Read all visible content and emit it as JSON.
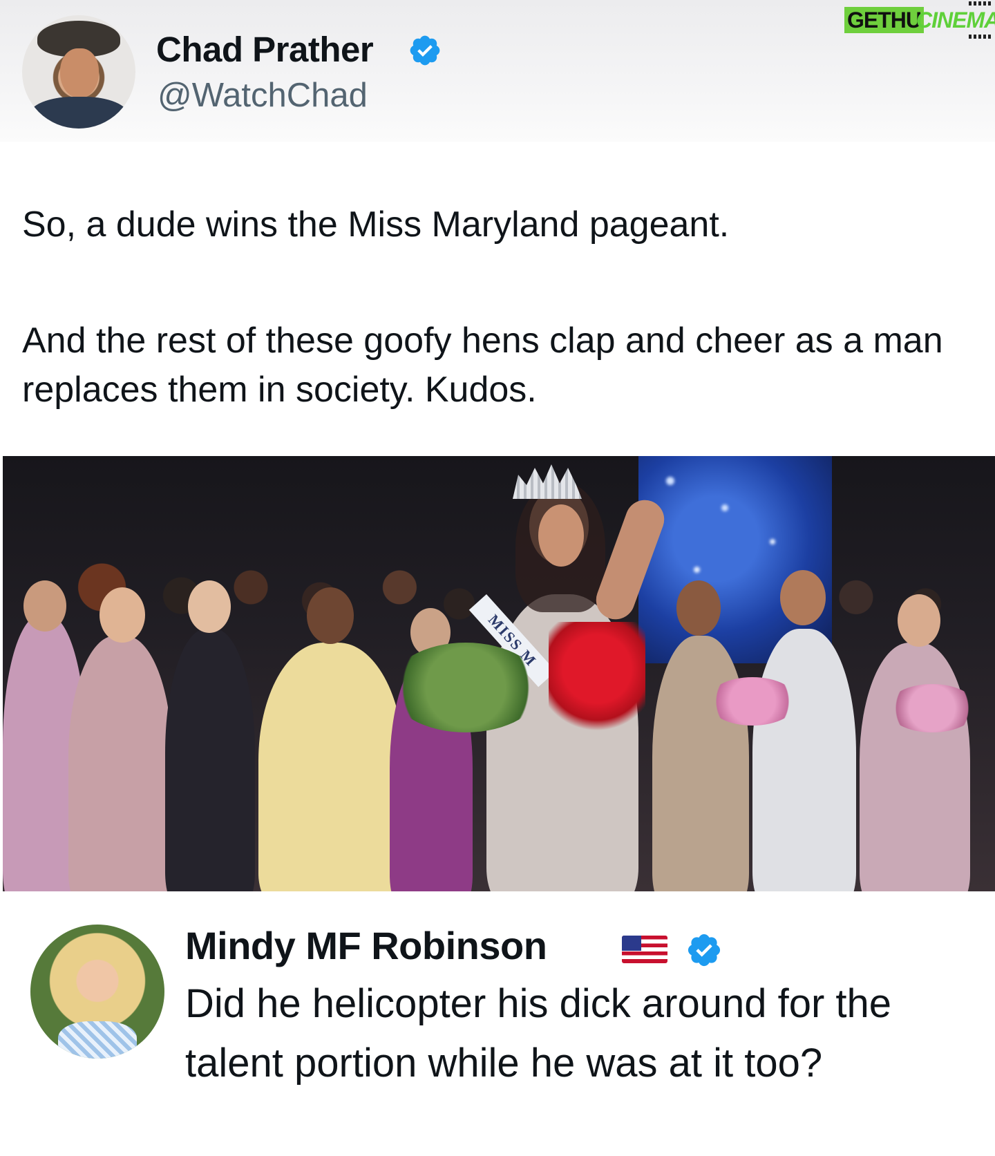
{
  "watermark": {
    "left": "GETHU",
    "right": "CINEMA"
  },
  "tweet": {
    "author_name": "Chad Prather",
    "author_handle": "@WatchChad",
    "verified": true,
    "text_line_1": "So, a dude wins the Miss Maryland pageant.",
    "text_line_2": "And the rest of these goofy hens clap and cheer as a man replaces them in society. Kudos.",
    "media": {
      "sash_text": "MISS M"
    }
  },
  "reply": {
    "author_name": "Mindy MF Robinson",
    "flag_emoji": "us-flag-icon",
    "verified": true,
    "text": "Did he helicopter his dick around for the talent portion while he was at it too?"
  },
  "colors": {
    "verified_blue": "#1d9bf0",
    "handle_gray": "#536471",
    "text": "#0f1419",
    "watermark_green": "#6fcf3d"
  }
}
